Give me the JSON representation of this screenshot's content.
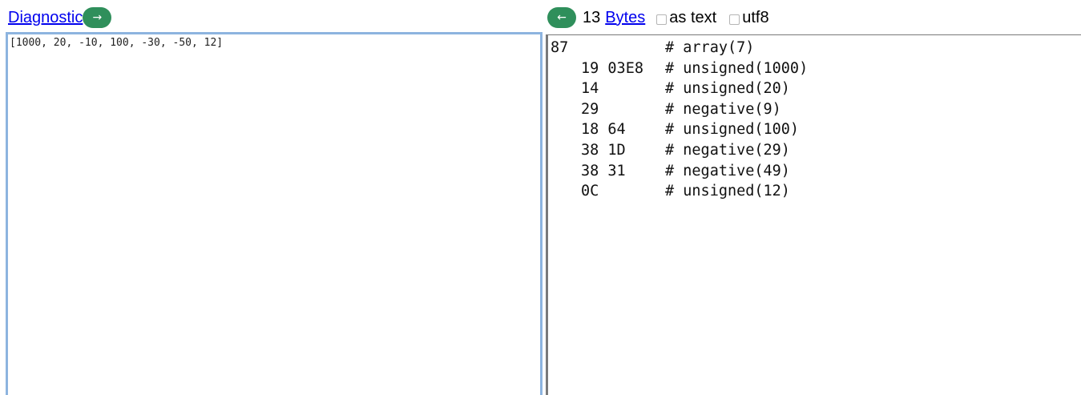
{
  "header": {
    "diagnostic_label": "Diagnostic",
    "forward_arrow": "→",
    "back_arrow": "←",
    "byte_count": "13",
    "bytes_label": "Bytes",
    "as_text_label": "as text",
    "utf8_label": "utf8",
    "as_text_checked": false,
    "utf8_checked": false
  },
  "input": {
    "value": "[1000, 20, -10, 100, -30, -50, 12]"
  },
  "output": {
    "lines": [
      {
        "indent": false,
        "bytes": "87",
        "comment": "# array(7)"
      },
      {
        "indent": true,
        "bytes": "19 03E8",
        "comment": "# unsigned(1000)"
      },
      {
        "indent": true,
        "bytes": "14",
        "comment": "# unsigned(20)"
      },
      {
        "indent": true,
        "bytes": "29",
        "comment": "# negative(9)"
      },
      {
        "indent": true,
        "bytes": "18 64",
        "comment": "# unsigned(100)"
      },
      {
        "indent": true,
        "bytes": "38 1D",
        "comment": "# negative(29)"
      },
      {
        "indent": true,
        "bytes": "38 31",
        "comment": "# negative(49)"
      },
      {
        "indent": true,
        "bytes": "0C",
        "comment": "# unsigned(12)"
      }
    ]
  },
  "colors": {
    "button_green": "#2f8f5b",
    "link_blue": "#0000ee",
    "textarea_focus_border": "#8db4df",
    "divider_gray": "#7a7a7a"
  }
}
